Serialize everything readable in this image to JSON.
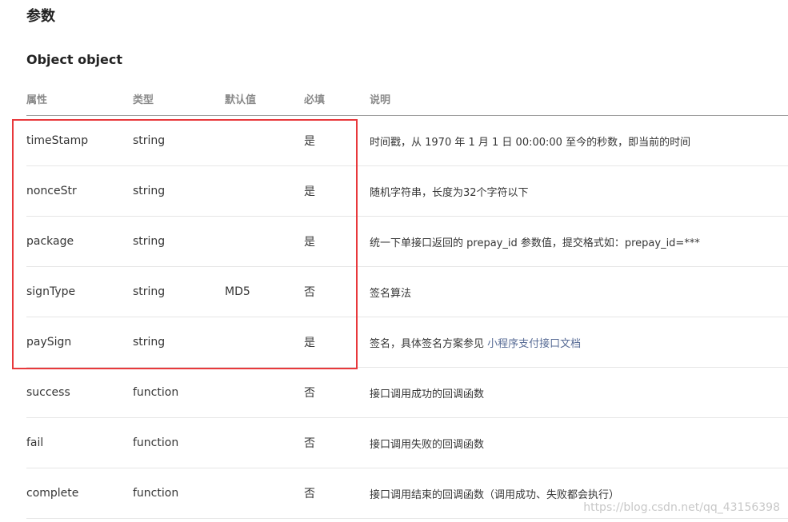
{
  "section_title": "参数",
  "object_title": "Object object",
  "columns": {
    "property": "属性",
    "type": "类型",
    "default": "默认值",
    "required": "必填",
    "description": "说明"
  },
  "rows": [
    {
      "name": "timeStamp",
      "type": "string",
      "default": "",
      "required": "是",
      "description": "时间戳，从 1970 年 1 月 1 日 00:00:00 至今的秒数，即当前的时间"
    },
    {
      "name": "nonceStr",
      "type": "string",
      "default": "",
      "required": "是",
      "description": "随机字符串，长度为32个字符以下"
    },
    {
      "name": "package",
      "type": "string",
      "default": "",
      "required": "是",
      "description": "统一下单接口返回的 prepay_id 参数值，提交格式如：prepay_id=***"
    },
    {
      "name": "signType",
      "type": "string",
      "default": "MD5",
      "required": "否",
      "description": "签名算法"
    },
    {
      "name": "paySign",
      "type": "string",
      "default": "",
      "required": "是",
      "description": "签名，具体签名方案参见 ",
      "link_text": "小程序支付接口文档"
    },
    {
      "name": "success",
      "type": "function",
      "default": "",
      "required": "否",
      "description": "接口调用成功的回调函数"
    },
    {
      "name": "fail",
      "type": "function",
      "default": "",
      "required": "否",
      "description": "接口调用失败的回调函数"
    },
    {
      "name": "complete",
      "type": "function",
      "default": "",
      "required": "否",
      "description": "接口调用结束的回调函数（调用成功、失败都会执行）"
    }
  ],
  "watermark": "https://blog.csdn.net/qq_43156398",
  "colors": {
    "highlight_border": "#e8393c",
    "link": "#576b95",
    "header_text": "#8a8a8a"
  }
}
